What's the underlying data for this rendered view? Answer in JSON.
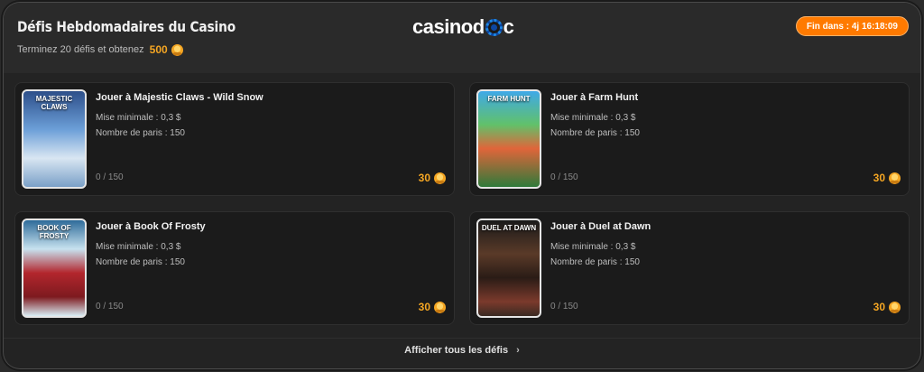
{
  "header": {
    "title": "Défis Hebdomadaires du Casino",
    "subtitle": "Terminez 20 défis et obtenez",
    "reward_total": "500",
    "logo_prefix": "casinod",
    "logo_suffix": "c",
    "timer": "Fin dans : 4j 16:18:09"
  },
  "challenges": [
    {
      "title": "Jouer à Majestic Claws - Wild Snow",
      "min_bet": "Mise minimale : 0,3 $",
      "bets": "Nombre de paris : 150",
      "progress": "0 / 150",
      "reward": "30",
      "thumb_label": "MAJESTIC CLAWS"
    },
    {
      "title": "Jouer à Farm Hunt",
      "min_bet": "Mise minimale : 0,3 $",
      "bets": "Nombre de paris : 150",
      "progress": "0 / 150",
      "reward": "30",
      "thumb_label": "FARM HUNT"
    },
    {
      "title": "Jouer à Book Of Frosty",
      "min_bet": "Mise minimale : 0,3 $",
      "bets": "Nombre de paris : 150",
      "progress": "0 / 150",
      "reward": "30",
      "thumb_label": "BOOK OF FROSTY"
    },
    {
      "title": "Jouer à Duel at Dawn",
      "min_bet": "Mise minimale : 0,3 $",
      "bets": "Nombre de paris : 150",
      "progress": "0 / 150",
      "reward": "30",
      "thumb_label": "DUEL AT DAWN"
    }
  ],
  "footer": {
    "show_all": "Afficher tous les défis"
  },
  "colors": {
    "accent": "#f5a623",
    "timer_bg": "#ff7a00",
    "card_bg": "#1b1b1b",
    "panel_bg": "#232323"
  },
  "icons": {
    "coin": "coin-icon",
    "chevron": "chevron-right-icon",
    "logo_chip": "poker-chip-icon"
  }
}
